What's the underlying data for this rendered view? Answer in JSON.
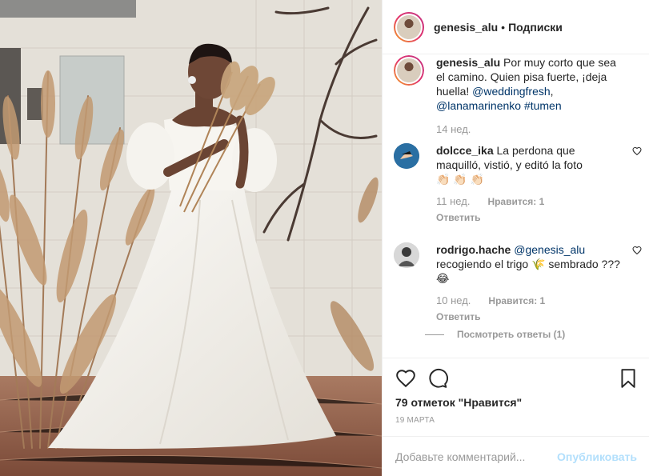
{
  "post": {
    "username": "genesis_alu",
    "separator": "•",
    "follow_label": "Подписки"
  },
  "caption": {
    "username": "genesis_alu",
    "text": "Por muy corto que sea el camino. Quien pisa fuerte, ¡deja huella!",
    "mention": "@weddingfresh",
    "comma": ",",
    "mention2": "@lanamarinenko",
    "hashtag": "#tumen",
    "time": "14 нед."
  },
  "comments": [
    {
      "username": "dolcce_ika",
      "text": "La perdona que maquilló, vistió, y editó la foto",
      "emoji": "👏🏻 👏🏻 👏🏻",
      "time": "11 нед.",
      "likes": "Нравится: 1",
      "reply_label": "Ответить"
    },
    {
      "username": "rodrigo.hache",
      "mention": "@genesis_alu",
      "text": "recogiendo el trigo 🌾 sembrado ??? 😂",
      "time": "10 нед.",
      "likes": "Нравится: 1",
      "reply_label": "Ответить",
      "view_replies": "Посмотреть ответы (1)"
    }
  ],
  "actions": {
    "likes_text": "79 отметок \"Нравится\"",
    "date": "19 МАРТА"
  },
  "add_comment": {
    "placeholder": "Добавьте комментарий...",
    "publish_label": "Опубликовать"
  },
  "icons": {
    "like": "heart-icon",
    "comment": "comment-icon",
    "save": "bookmark-icon",
    "comment_like": "heart-icon"
  },
  "colors": {
    "link": "#003569",
    "muted": "#999999",
    "publish_disabled": "#b2dffc",
    "border": "#efefef"
  }
}
